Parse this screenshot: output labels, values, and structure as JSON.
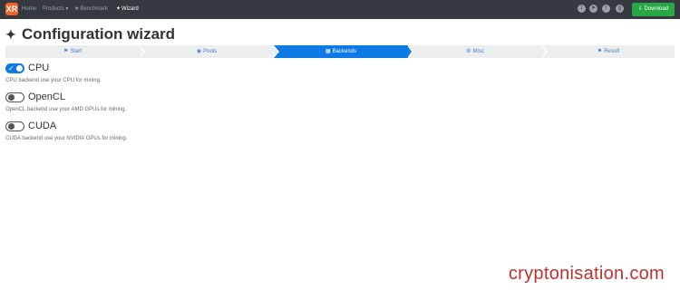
{
  "navbar": {
    "brand_glyph": "XR",
    "links": [
      {
        "label": "Home",
        "icon": ""
      },
      {
        "label": "Products ▾",
        "icon": ""
      },
      {
        "label": "Benchmark",
        "icon": "trophy-icon"
      },
      {
        "label": "Wizard",
        "icon": "magic-wand-icon"
      }
    ],
    "social_icons": [
      "twitter-icon",
      "telegram-icon",
      "reddit-icon",
      "github-icon"
    ],
    "download_label": "Download"
  },
  "page": {
    "title": "Configuration wizard"
  },
  "wizard": {
    "steps": [
      {
        "label": "Start",
        "icon": "flag-icon",
        "active": false
      },
      {
        "label": "Pools",
        "icon": "database-icon",
        "active": false
      },
      {
        "label": "Backends",
        "icon": "microchip-icon",
        "active": true
      },
      {
        "label": "Misc",
        "icon": "cog-icon",
        "active": false
      },
      {
        "label": "Result",
        "icon": "flag-checkered-icon",
        "active": false
      }
    ]
  },
  "backends": [
    {
      "name": "CPU",
      "description": "CPU backend use your CPU for mining.",
      "enabled": true
    },
    {
      "name": "OpenCL",
      "description": "OpenCL backend use your AMD GPUs for mining.",
      "enabled": false
    },
    {
      "name": "CUDA",
      "description": "CUDA backend use your NVIDIA GPUs for mining.",
      "enabled": false
    }
  ],
  "watermark": "cryptonisation.com",
  "colors": {
    "navbar": "#343a40",
    "accent": "#0d7ae6",
    "download": "#28a745",
    "brand": "#f0632a",
    "watermark": "#c0312c"
  }
}
